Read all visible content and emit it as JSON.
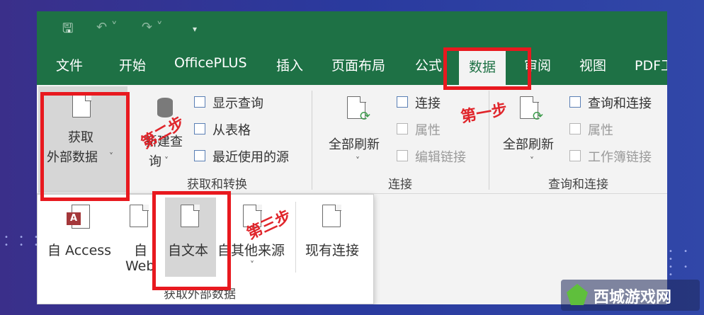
{
  "quick_access": {
    "save_icon": "save-icon",
    "undo_icon": "undo-icon",
    "redo_icon": "redo-icon",
    "customize_icon": "customize-qat-icon"
  },
  "tabs": [
    "文件",
    "开始",
    "OfficePLUS",
    "插入",
    "页面布局",
    "公式",
    "数据",
    "审阅",
    "视图",
    "PDF工"
  ],
  "active_tab": "数据",
  "ribbon": {
    "get_external": {
      "line1": "获取",
      "line2": "外部数据"
    },
    "new_query": {
      "line1": "新建查",
      "line2": "询"
    },
    "show_queries": "显示查询",
    "from_table": "从表格",
    "recent_sources": "最近使用的源",
    "group_get_transform": "获取和转换",
    "refresh_all_1": "全部刷新",
    "connections": "连接",
    "properties_1": "属性",
    "edit_links": "编辑链接",
    "group_connections": "连接",
    "refresh_all_2": "全部刷新",
    "queries_connections": "查询和连接",
    "properties_2": "属性",
    "workbook_links": "工作簿链接",
    "group_queries_connections": "查询和连接"
  },
  "dropdown": {
    "from_access": "自 Access",
    "from_web_1": "自",
    "from_web_2": "Web",
    "from_text": "自文本",
    "from_other": "自其他来源",
    "existing_connections": "现有连接",
    "group_label": "获取外部数据"
  },
  "annotations": {
    "step1": "第一步",
    "step2": "第二步",
    "step3": "第三步",
    "color": "#e8191f"
  },
  "watermark": {
    "text": "西城游戏网"
  },
  "colors": {
    "excel_green": "#1e7145"
  }
}
